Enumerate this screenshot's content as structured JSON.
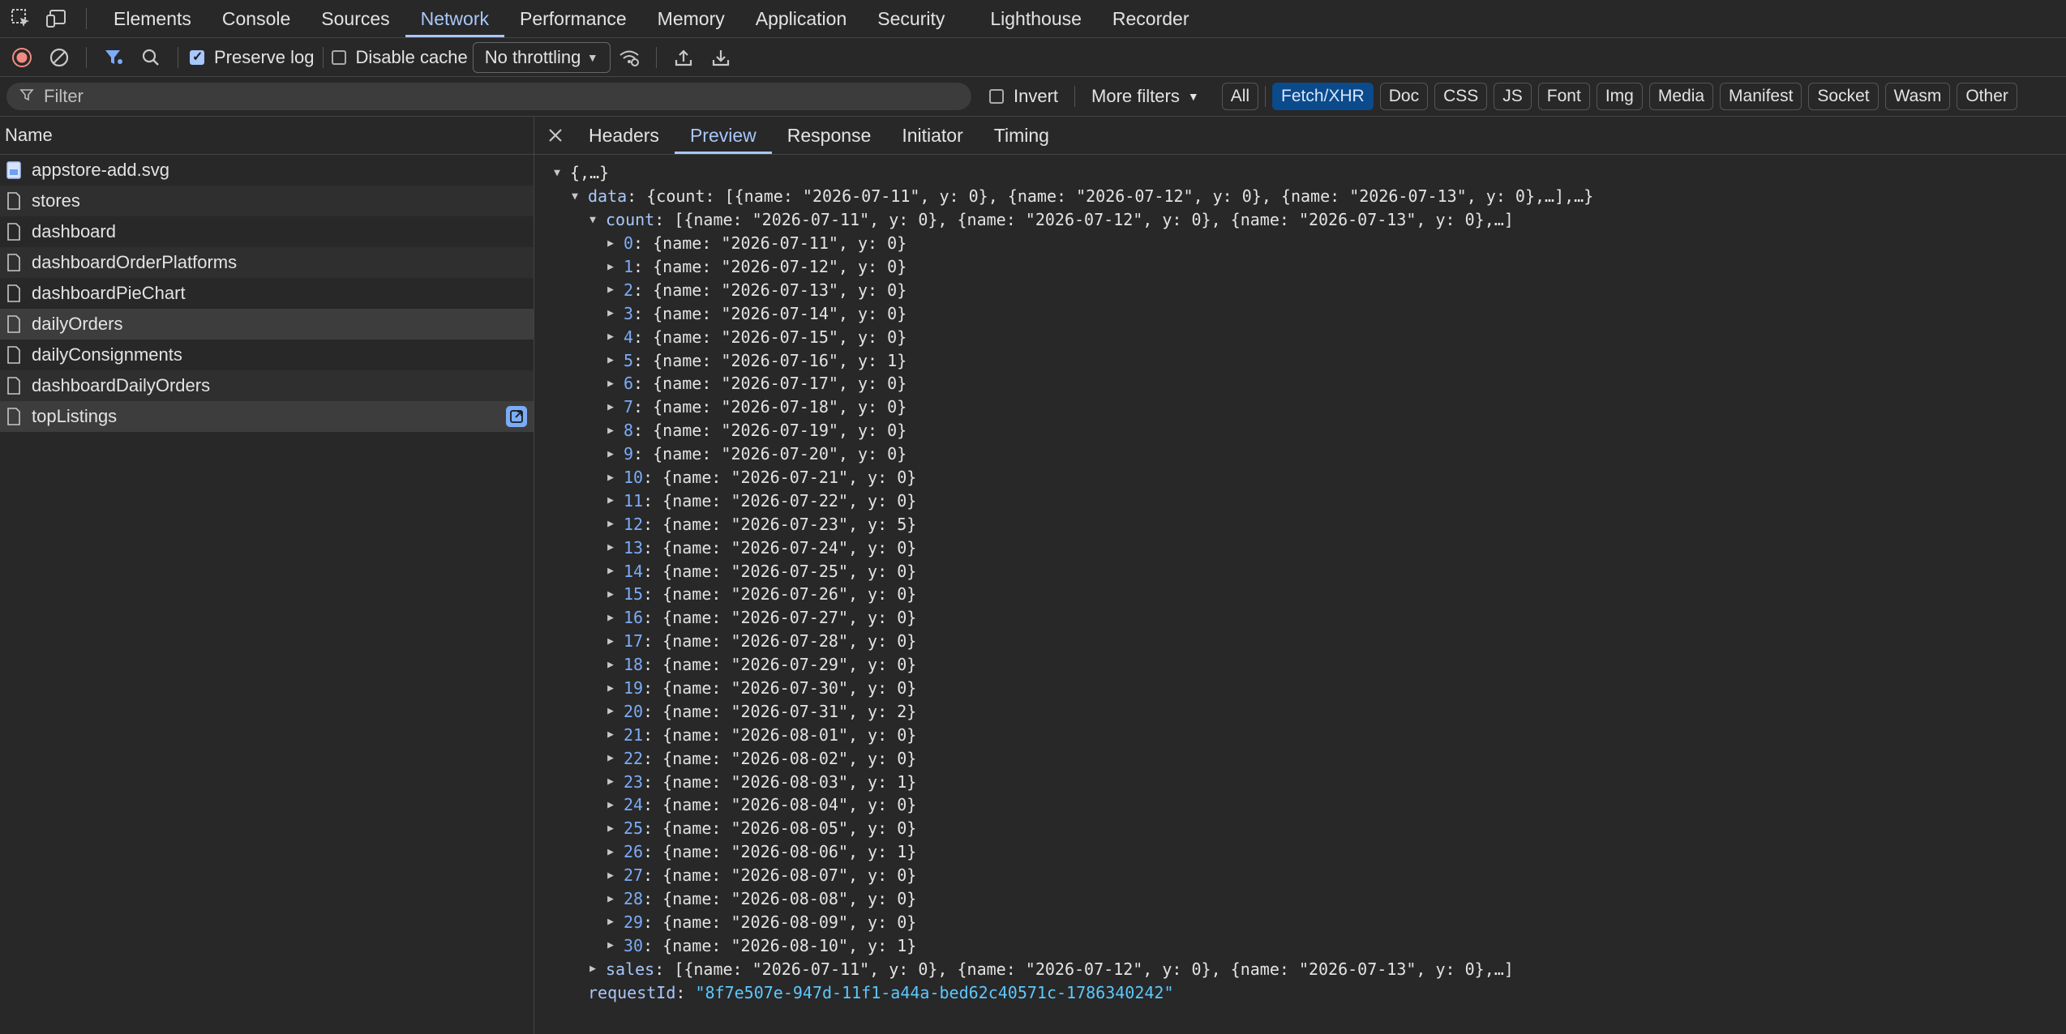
{
  "tabs": [
    "Elements",
    "Console",
    "Sources",
    "Network",
    "Performance",
    "Memory",
    "Application",
    "Security",
    "Lighthouse",
    "Recorder"
  ],
  "active_tab": "Network",
  "toolbar": {
    "preserve_log_label": "Preserve log",
    "preserve_log_checked": true,
    "disable_cache_label": "Disable cache",
    "disable_cache_checked": false,
    "throttling_value": "No throttling"
  },
  "filter": {
    "placeholder": "Filter",
    "invert_label": "Invert",
    "more_filters_label": "More filters",
    "types": [
      "All",
      "Fetch/XHR",
      "Doc",
      "CSS",
      "JS",
      "Font",
      "Img",
      "Media",
      "Manifest",
      "Socket",
      "Wasm",
      "Other"
    ],
    "active_type": "Fetch/XHR"
  },
  "requests": {
    "header": "Name",
    "items": [
      {
        "name": "appstore-add.svg",
        "icon": "image-file-icon"
      },
      {
        "name": "stores",
        "icon": "document-icon"
      },
      {
        "name": "dashboard",
        "icon": "document-icon"
      },
      {
        "name": "dashboardOrderPlatforms",
        "icon": "document-icon"
      },
      {
        "name": "dashboardPieChart",
        "icon": "document-icon"
      },
      {
        "name": "dailyOrders",
        "icon": "document-icon",
        "selected": true
      },
      {
        "name": "dailyConsignments",
        "icon": "document-icon"
      },
      {
        "name": "dashboardDailyOrders",
        "icon": "document-icon"
      },
      {
        "name": "topListings",
        "icon": "document-icon",
        "hovered": true
      }
    ]
  },
  "detail_tabs": [
    "Headers",
    "Preview",
    "Response",
    "Initiator",
    "Timing"
  ],
  "active_detail_tab": "Preview",
  "preview": {
    "root": "{,…}",
    "data_key": "data",
    "data_summary": "{count: [{name: \"2026-07-11\", y: 0}, {name: \"2026-07-12\", y: 0}, {name: \"2026-07-13\", y: 0},…],…}",
    "count_key": "count",
    "count_summary": "[{name: \"2026-07-11\", y: 0}, {name: \"2026-07-12\", y: 0}, {name: \"2026-07-13\", y: 0},…]",
    "count_items": [
      {
        "i": "0",
        "name": "2026-07-11",
        "y": 0
      },
      {
        "i": "1",
        "name": "2026-07-12",
        "y": 0
      },
      {
        "i": "2",
        "name": "2026-07-13",
        "y": 0
      },
      {
        "i": "3",
        "name": "2026-07-14",
        "y": 0
      },
      {
        "i": "4",
        "name": "2026-07-15",
        "y": 0
      },
      {
        "i": "5",
        "name": "2026-07-16",
        "y": 1
      },
      {
        "i": "6",
        "name": "2026-07-17",
        "y": 0
      },
      {
        "i": "7",
        "name": "2026-07-18",
        "y": 0
      },
      {
        "i": "8",
        "name": "2026-07-19",
        "y": 0
      },
      {
        "i": "9",
        "name": "2026-07-20",
        "y": 0
      },
      {
        "i": "10",
        "name": "2026-07-21",
        "y": 0
      },
      {
        "i": "11",
        "name": "2026-07-22",
        "y": 0
      },
      {
        "i": "12",
        "name": "2026-07-23",
        "y": 5
      },
      {
        "i": "13",
        "name": "2026-07-24",
        "y": 0
      },
      {
        "i": "14",
        "name": "2026-07-25",
        "y": 0
      },
      {
        "i": "15",
        "name": "2026-07-26",
        "y": 0
      },
      {
        "i": "16",
        "name": "2026-07-27",
        "y": 0
      },
      {
        "i": "17",
        "name": "2026-07-28",
        "y": 0
      },
      {
        "i": "18",
        "name": "2026-07-29",
        "y": 0
      },
      {
        "i": "19",
        "name": "2026-07-30",
        "y": 0
      },
      {
        "i": "20",
        "name": "2026-07-31",
        "y": 2
      },
      {
        "i": "21",
        "name": "2026-08-01",
        "y": 0
      },
      {
        "i": "22",
        "name": "2026-08-02",
        "y": 0
      },
      {
        "i": "23",
        "name": "2026-08-03",
        "y": 1
      },
      {
        "i": "24",
        "name": "2026-08-04",
        "y": 0
      },
      {
        "i": "25",
        "name": "2026-08-05",
        "y": 0
      },
      {
        "i": "26",
        "name": "2026-08-06",
        "y": 1
      },
      {
        "i": "27",
        "name": "2026-08-07",
        "y": 0
      },
      {
        "i": "28",
        "name": "2026-08-08",
        "y": 0
      },
      {
        "i": "29",
        "name": "2026-08-09",
        "y": 0
      },
      {
        "i": "30",
        "name": "2026-08-10",
        "y": 1
      }
    ],
    "sales_key": "sales",
    "sales_summary": "[{name: \"2026-07-11\", y: 0}, {name: \"2026-07-12\", y: 0}, {name: \"2026-07-13\", y: 0},…]",
    "request_id_key": "requestId",
    "request_id_value": "\"8f7e507e-947d-11f1-a44a-bed62c40571c-1786340242\""
  }
}
